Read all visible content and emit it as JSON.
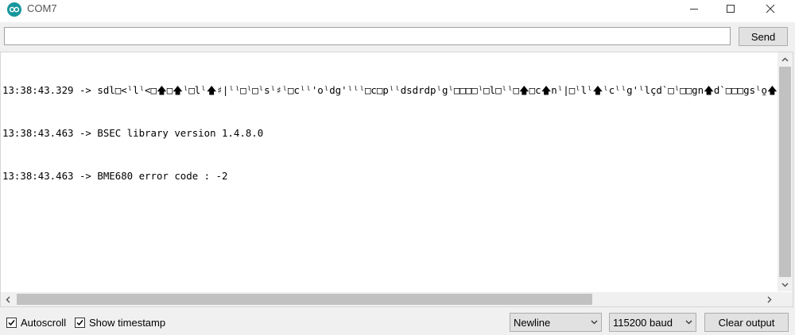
{
  "window": {
    "title": "COM7",
    "logo_icon": "arduino-logo-icon",
    "accent_color": "#16979c"
  },
  "send_row": {
    "input_value": "",
    "send_label": "Send"
  },
  "output": {
    "lines": [
      "13:38:43.329 -> sdl□<ˡlˡ<□🡅□🡅ˡ□lˡ🡅♯|ˡˡ□ˡ□ˡsˡ♯ˡ□cˡˡ'oˡdg'ˡˡˡ□c□pˡˡdsdrdpˡgˡ□□□□ˡ□l□ˡˡ□🡅□c🡅nˡ|□ˡlˡ🡅ˡcˡˡg'ˡlçd`□ˡ□□gn🡅d`□□□gsˡ̱o🡅",
      "13:38:43.463 -> BSEC library version 1.4.8.0",
      "13:38:43.463 -> BME680 error code : -2"
    ]
  },
  "controls": {
    "autoscroll_label": "Autoscroll",
    "autoscroll_checked": true,
    "timestamp_label": "Show timestamp",
    "timestamp_checked": true,
    "line_ending_value": "Newline",
    "baud_value": "115200 baud",
    "clear_label": "Clear output"
  },
  "icons": {
    "minimize": "minimize-icon",
    "maximize": "maximize-icon",
    "close": "close-icon",
    "scroll_up": "chevron-up-icon",
    "scroll_down": "chevron-down-icon",
    "scroll_left": "chevron-left-icon",
    "scroll_right": "chevron-right-icon",
    "dropdown": "chevron-down-icon",
    "checkmark": "checkmark-icon"
  }
}
